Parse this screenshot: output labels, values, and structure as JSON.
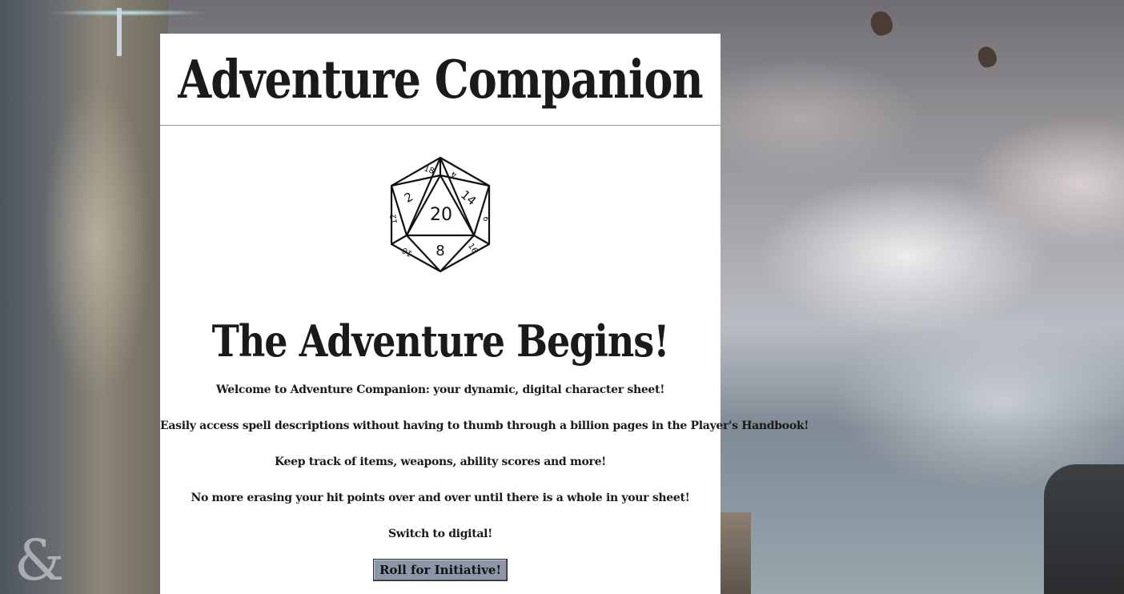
{
  "header": {
    "title": "Adventure Companion"
  },
  "hero": {
    "dice_icon": "d20-icon",
    "dice_face_numbers": [
      "20",
      "2",
      "14",
      "8",
      "18",
      "4",
      "16",
      "10",
      "12",
      "6"
    ]
  },
  "main": {
    "heading": "The Adventure Begins!",
    "paragraphs": [
      "Welcome to Adventure Companion: your dynamic, digital character sheet!",
      "Easily access spell descriptions without having to thumb through a billion pages in the Player's Handbook!",
      "Keep track of items, weapons, ability scores and more!",
      "No more erasing your hit points over and over until there is a whole in your sheet!",
      "Switch to digital!"
    ],
    "button_label": "Roll for Initiative!"
  },
  "background": {
    "logo_icon": "ampersand-logo-icon"
  },
  "colors": {
    "panel": "#ffffff",
    "button": "#8d96a8",
    "text": "#1a1a1a"
  }
}
